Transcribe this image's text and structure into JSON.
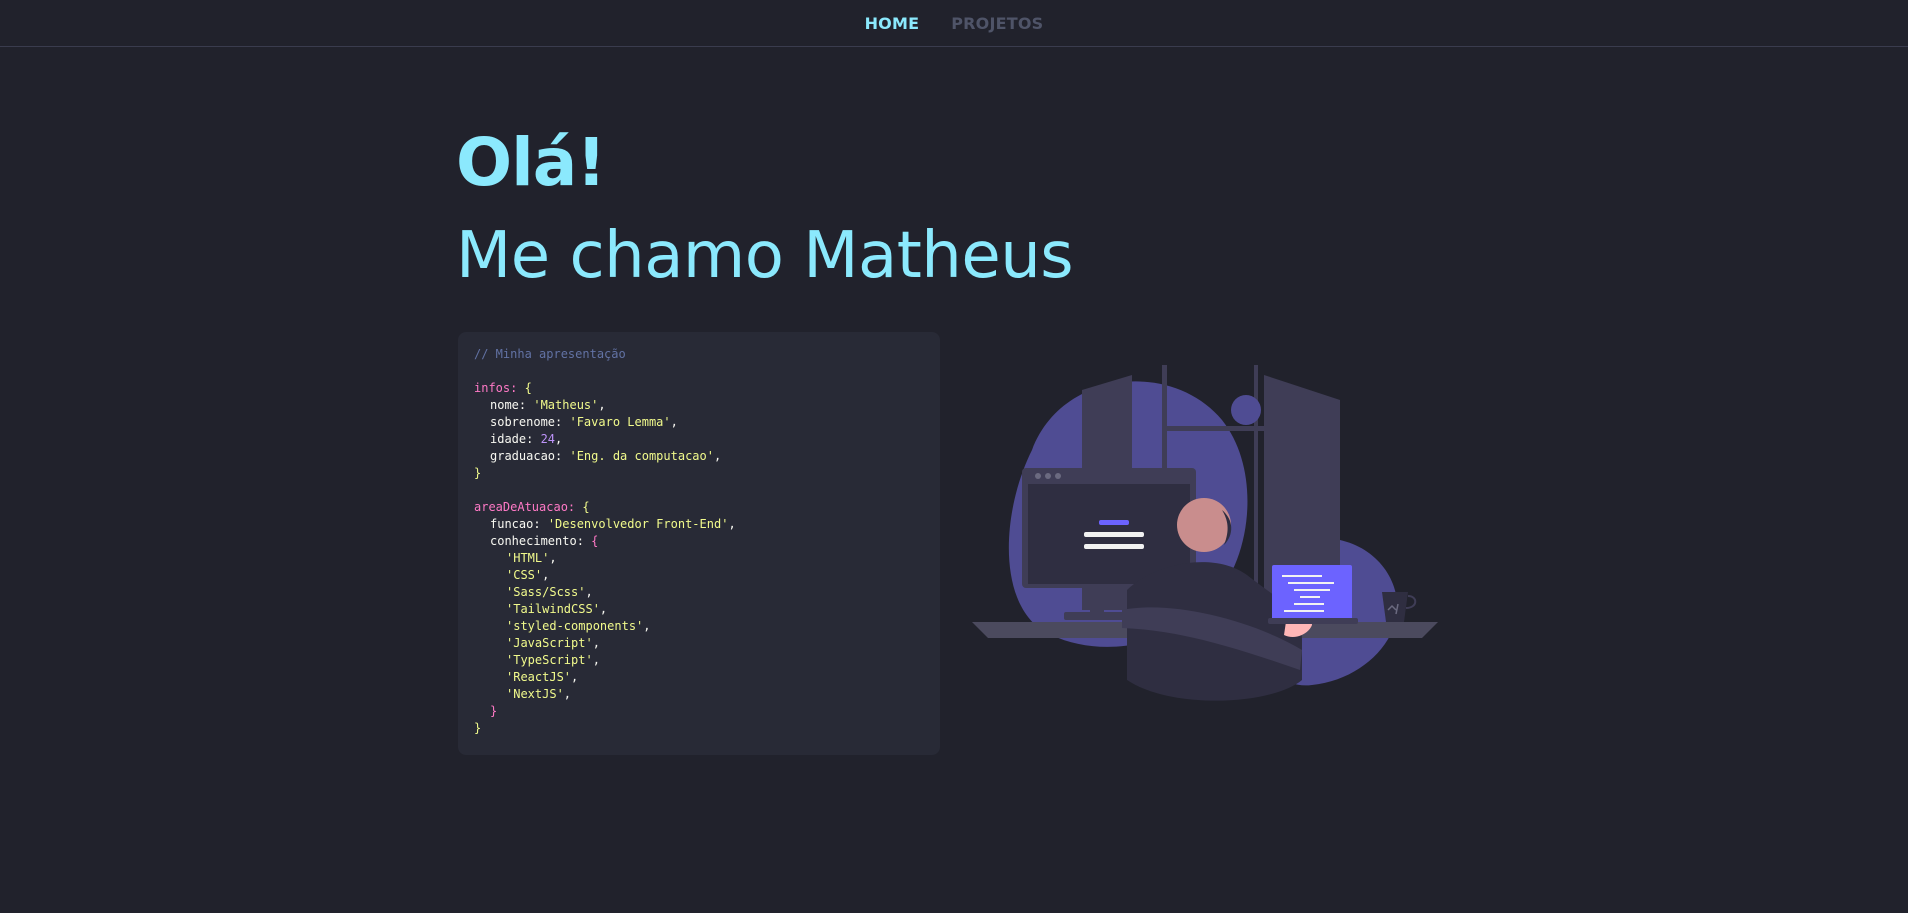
{
  "nav": {
    "home_label": "HOME",
    "projects_label": "PROJETOS"
  },
  "hero": {
    "greeting": "Olá!",
    "intro": "Me chamo Matheus"
  },
  "code": {
    "comment": "// Minha apresentação",
    "infos_key": "infos",
    "infos": [
      {
        "prop": "nome",
        "value": "'Matheus'",
        "type": "str"
      },
      {
        "prop": "sobrenome",
        "value": "'Favaro Lemma'",
        "type": "str"
      },
      {
        "prop": "idade",
        "value": "24",
        "type": "num"
      },
      {
        "prop": "graduacao",
        "value": "'Eng. da computacao'",
        "type": "str"
      }
    ],
    "area_key": "areaDeAtuacao",
    "funcao_prop": "funcao",
    "funcao_value": "'Desenvolvedor Front-End'",
    "conhecimento_prop": "conhecimento",
    "conhecimento": [
      "'HTML'",
      "'CSS'",
      "'Sass/Scss'",
      "'TailwindCSS'",
      "'styled-components'",
      "'JavaScript'",
      "'TypeScript'",
      "'ReactJS'",
      "'NextJS'"
    ]
  },
  "illustration": {
    "icon": "developer-at-desk-illustration",
    "colors": {
      "blob": "#4f4c93",
      "monitor_frame": "#3f3d56",
      "screen": "#2f2e41",
      "accent": "#6c63ff",
      "skin": "#ffb6b6",
      "hair": "#2f2e41"
    }
  }
}
